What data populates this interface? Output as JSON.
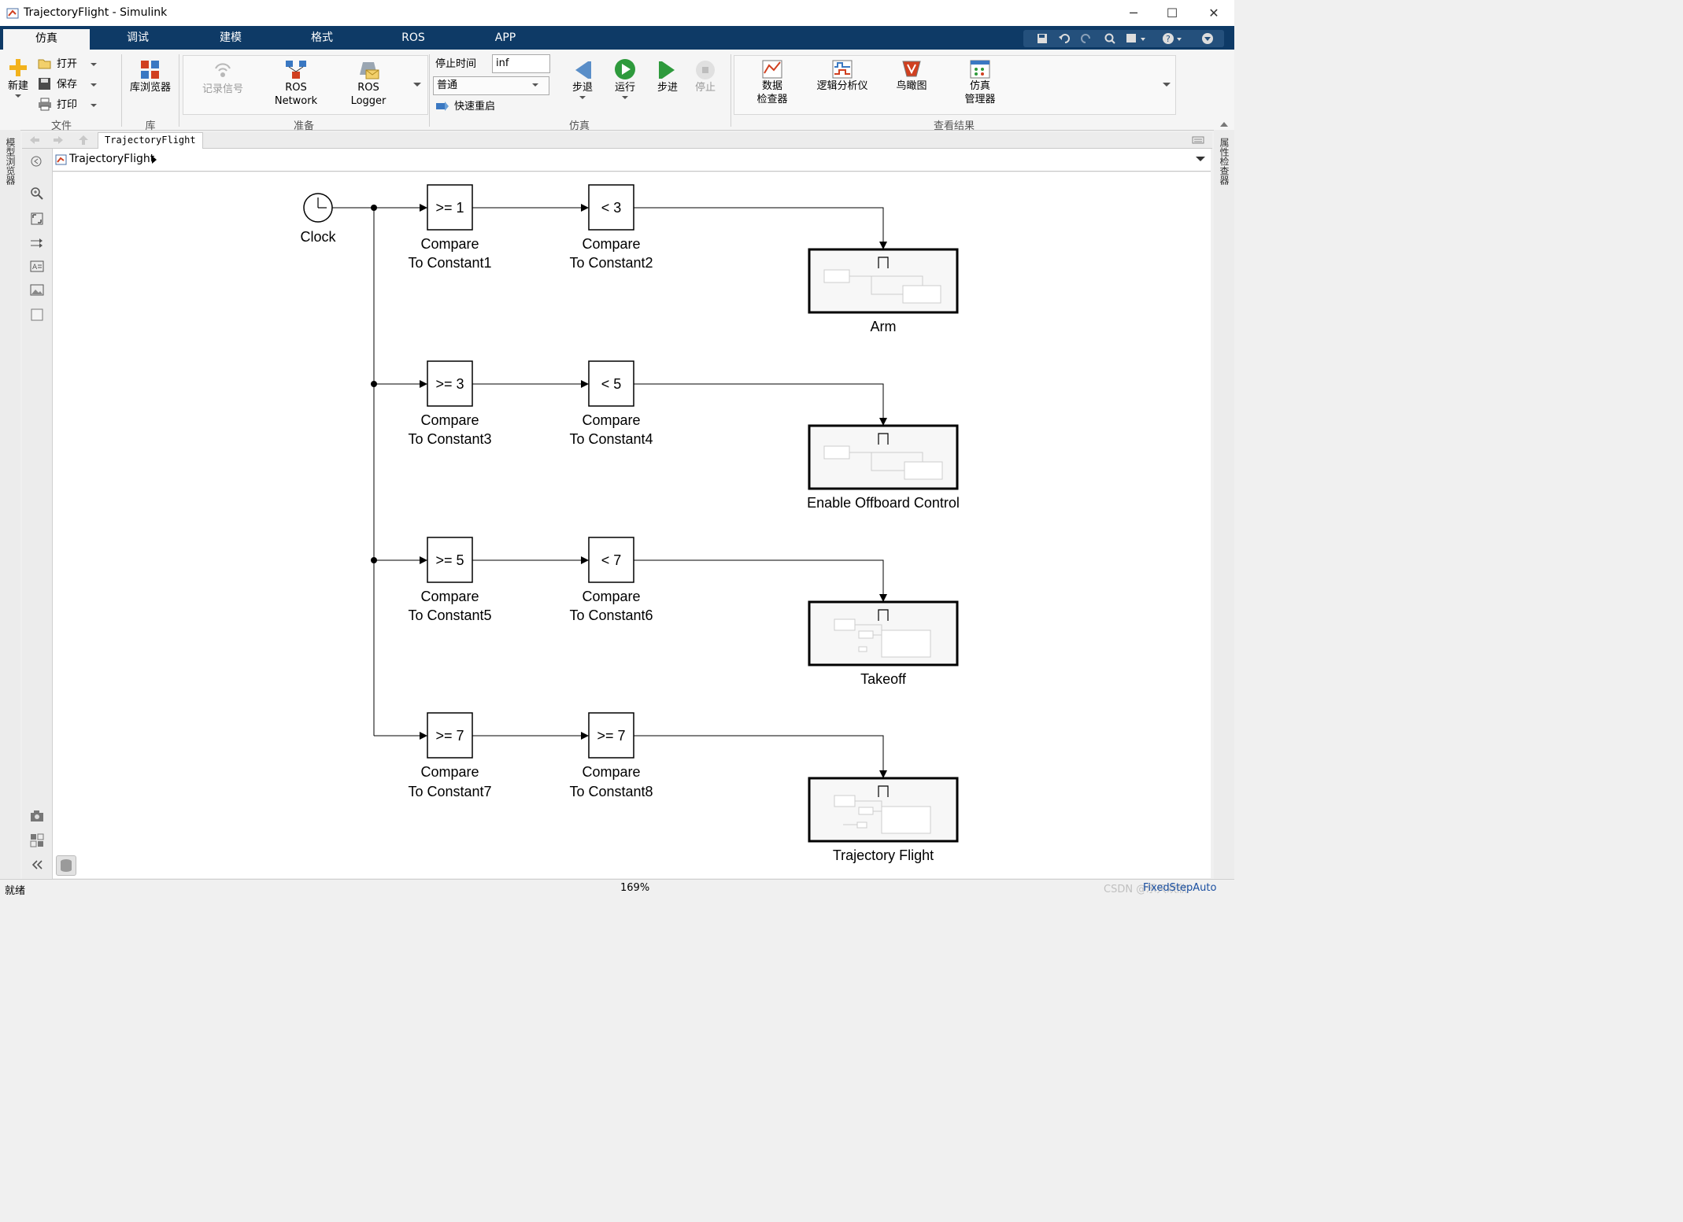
{
  "window": {
    "title": "TrajectoryFlight - Simulink",
    "minimize": "─",
    "maximize": "☐",
    "close": "✕"
  },
  "tabs": [
    "仿真",
    "调试",
    "建模",
    "格式",
    "ROS",
    "APP"
  ],
  "toolstrip": {
    "file": {
      "new": "新建",
      "open": "打开",
      "save": "保存",
      "print": "打印",
      "section": "文件"
    },
    "library": {
      "browser": "库浏览器",
      "section": "库"
    },
    "prepare": {
      "log_signals": "记录信号",
      "ros_network": [
        "ROS",
        "Network"
      ],
      "ros_logger": [
        "ROS",
        "Logger"
      ],
      "section": "准备"
    },
    "simulate": {
      "stop_time_label": "停止时间",
      "stop_time_value": "inf",
      "mode": "普通",
      "fast_restart": "快速重启",
      "step_back": "步退",
      "run": "运行",
      "step_forward": "步进",
      "stop": "停止",
      "section": "仿真"
    },
    "review": {
      "data_inspector": [
        "数据",
        "检查器"
      ],
      "logic_analyzer": "逻辑分析仪",
      "birdseye": "鸟瞰图",
      "sim_manager": [
        "仿真",
        "管理器"
      ],
      "section": "查看结果"
    }
  },
  "breadcrumb": {
    "tab": "TrajectoryFlight",
    "path": "TrajectoryFlight"
  },
  "side_panels": {
    "left": "模型浏览器",
    "right": "属性检查器"
  },
  "diagram": {
    "clock_label": "Clock",
    "rows": [
      {
        "cmp1": ">= 1",
        "cmp1_name": [
          "Compare",
          "To Constant1"
        ],
        "cmp2": "< 3",
        "cmp2_name": [
          "Compare",
          "To Constant2"
        ],
        "subsystem": "Arm"
      },
      {
        "cmp1": ">= 3",
        "cmp1_name": [
          "Compare",
          "To Constant3"
        ],
        "cmp2": "< 5",
        "cmp2_name": [
          "Compare",
          "To Constant4"
        ],
        "subsystem": "Enable Offboard Control"
      },
      {
        "cmp1": ">= 5",
        "cmp1_name": [
          "Compare",
          "To Constant5"
        ],
        "cmp2": "< 7",
        "cmp2_name": [
          "Compare",
          "To Constant6"
        ],
        "subsystem": "Takeoff"
      },
      {
        "cmp1": ">= 7",
        "cmp1_name": [
          "Compare",
          "To Constant7"
        ],
        "cmp2": ">= 7",
        "cmp2_name": [
          "Compare",
          "To Constant8"
        ],
        "subsystem": "Trajectory Flight"
      }
    ]
  },
  "status": {
    "ready": "就绪",
    "zoom": "169%",
    "solver": "FixedStepAuto",
    "watermark": "CSDN @乐只欢欣"
  },
  "colors": {
    "tab_bar": "#0e3a66",
    "canvas": "#ffffff",
    "block_border": "#000000"
  }
}
